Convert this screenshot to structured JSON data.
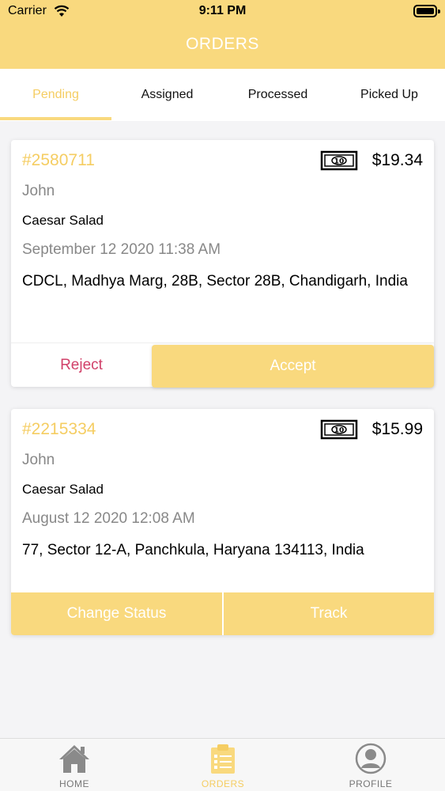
{
  "status_bar": {
    "carrier": "Carrier",
    "time": "9:11 PM"
  },
  "header": {
    "title": "ORDERS"
  },
  "tabs": [
    {
      "label": "Pending",
      "active": true
    },
    {
      "label": "Assigned",
      "active": false
    },
    {
      "label": "Processed",
      "active": false
    },
    {
      "label": "Picked Up",
      "active": false
    }
  ],
  "orders": [
    {
      "id": "#2580711",
      "price": "$19.34",
      "customer": "John",
      "item": "Caesar Salad",
      "date": "September 12 2020 11:38 AM",
      "address": "CDCL, Madhya Marg, 28B, Sector 28B, Chandigarh, India",
      "actions": {
        "reject": "Reject",
        "accept": "Accept"
      }
    },
    {
      "id": "#2215334",
      "price": "$15.99",
      "customer": "John",
      "item": "Caesar Salad",
      "date": "August 12 2020 12:08 AM",
      "address": "77, Sector 12-A, Panchkula, Haryana 134113, India",
      "actions": {
        "change_status": "Change Status",
        "track": "Track"
      }
    }
  ],
  "bottom_nav": [
    {
      "label": "HOME",
      "icon": "home-icon",
      "active": false
    },
    {
      "label": "ORDERS",
      "icon": "clipboard-list-icon",
      "active": true
    },
    {
      "label": "PROFILE",
      "icon": "user-circle-icon",
      "active": false
    }
  ],
  "colors": {
    "accent": "#f9d97e",
    "accent_text": "#f5cd62",
    "reject": "#d1416a"
  }
}
